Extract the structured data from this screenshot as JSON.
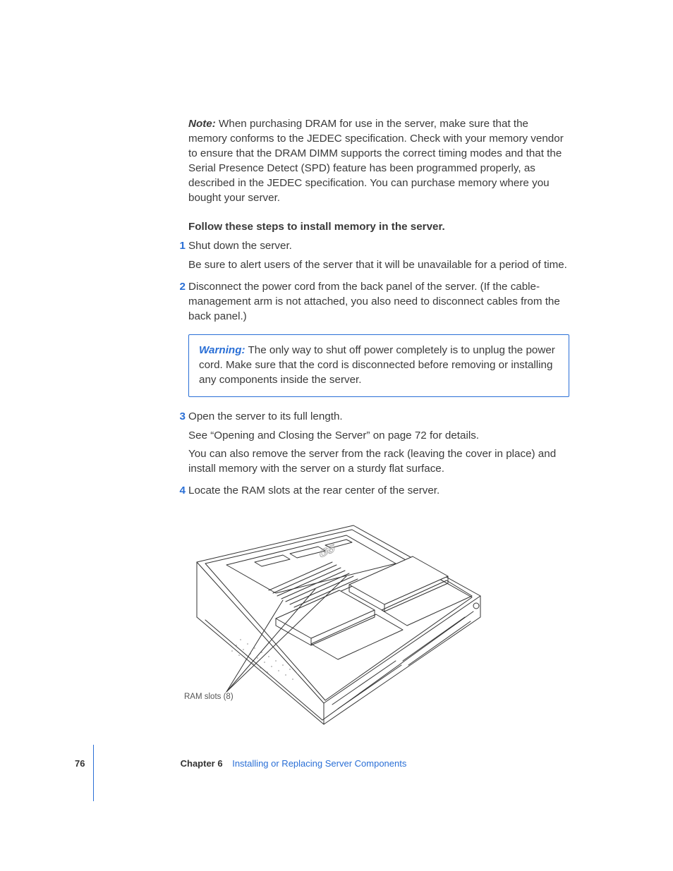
{
  "note": {
    "label": "Note:",
    "text": "When purchasing DRAM for use in the server, make sure that the memory conforms to the JEDEC specification. Check with your memory vendor to ensure that the DRAM DIMM supports the correct timing modes and that the Serial Presence Detect (SPD) feature has been programmed properly, as described in the JEDEC specification. You can purchase memory where you bought your server."
  },
  "steps_heading": "Follow these steps to install memory in the server.",
  "steps": [
    {
      "num": "1",
      "text": "Shut down the server.",
      "details": [
        "Be sure to alert users of the server that it will be unavailable for a period of time."
      ]
    },
    {
      "num": "2",
      "text": "Disconnect the power cord from the back panel of the server. (If the cable-management arm is not attached, you also need to disconnect cables from the back panel.)",
      "details": []
    },
    {
      "num": "3",
      "text": "Open the server to its full length.",
      "details": [
        "See “Opening and Closing the Server” on page 72 for details.",
        "You can also remove the server from the rack (leaving the cover in place) and install memory with the server on a sturdy flat surface."
      ]
    },
    {
      "num": "4",
      "text": "Locate the RAM slots at the rear center of the server.",
      "details": []
    }
  ],
  "warning": {
    "label": "Warning:",
    "text": "The only way to shut off power completely is to unplug the power cord. Make sure that the cord is disconnected before removing or installing any components inside the server."
  },
  "figure": {
    "caption": "RAM slots (8)",
    "cpu_labels": [
      "G5",
      "G5"
    ]
  },
  "footer": {
    "page_number": "76",
    "chapter_label": "Chapter 6",
    "chapter_title": "Installing or Replacing Server Components"
  }
}
